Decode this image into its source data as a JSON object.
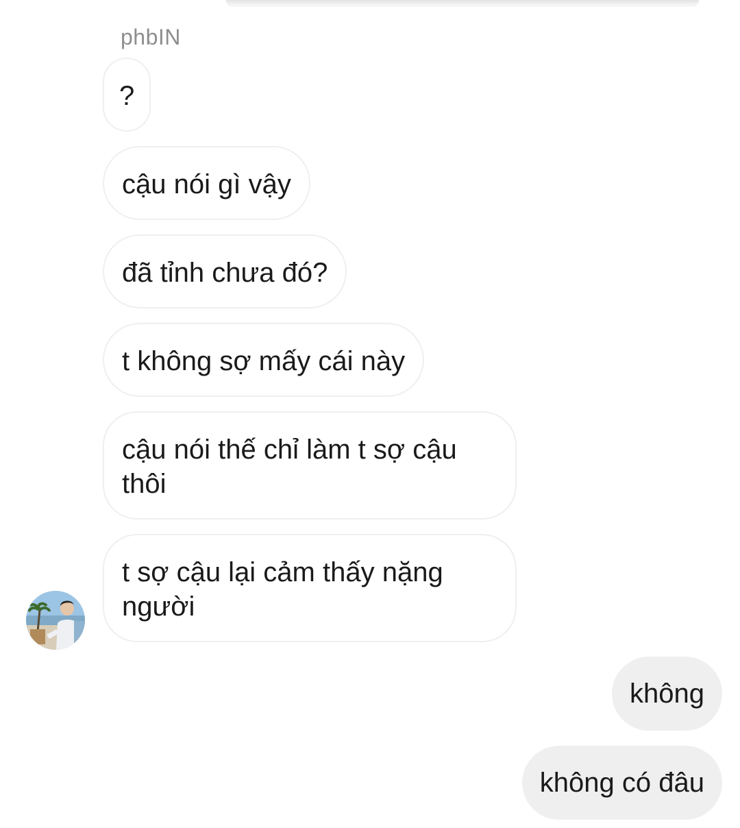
{
  "conversation": {
    "sender_name": "phbIN",
    "incoming": [
      {
        "text": "?"
      },
      {
        "text": "cậu nói gì vậy"
      },
      {
        "text": "đã tỉnh chưa đó?"
      },
      {
        "text": "t không sợ mấy cái này"
      },
      {
        "text": "cậu nói thế chỉ làm t sợ cậu thôi"
      },
      {
        "text": "t sợ cậu lại cảm thấy nặng người"
      }
    ],
    "outgoing": [
      {
        "text": "không"
      },
      {
        "text": "không có đâu"
      }
    ]
  },
  "colors": {
    "background": "#ffffff",
    "incoming_bubble": "#ffffff",
    "incoming_border": "#efefef",
    "outgoing_bubble": "#efefef",
    "text": "#1a1a1a",
    "sender_name": "#8e8e8e"
  },
  "icons": {
    "avatar": "profile-photo-avatar"
  }
}
